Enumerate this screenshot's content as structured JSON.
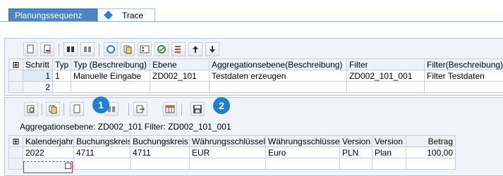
{
  "tabs": [
    {
      "label": "Planungssequenz",
      "active": true
    },
    {
      "label": "Trace",
      "active": false
    }
  ],
  "upper_grid": {
    "headers": [
      "Schritt",
      "Typ",
      "Typ (Beschreibung)",
      "Ebene",
      "Aggregationsebene(Beschreibung)",
      "Filter",
      "Filter(Beschreibung)"
    ],
    "rows": [
      [
        "1",
        "1",
        "Manuelle Eingabe",
        "ZD002_101",
        "Testdaten erzeugen",
        "ZD002_101_001",
        "Filter Testdaten"
      ],
      [
        "2",
        "",
        "",
        "",
        "",
        "",
        ""
      ]
    ]
  },
  "info_line": "Aggregationsebene: ZD002_101 Filter: ZD002_101_001",
  "lower_grid": {
    "headers": [
      "Kalenderjahr",
      "Buchungskreis",
      "Buchungskreis",
      "Währungsschlüssel",
      "Währungsschlüssel",
      "Version",
      "Version",
      "Betrag"
    ],
    "rows": [
      [
        "2022",
        "4711",
        "4711",
        "EUR",
        "Euro",
        "PLN",
        "Plan",
        "100,00"
      ]
    ]
  },
  "badges": [
    "1",
    "2"
  ],
  "colors": {
    "tab_active": "#4a86c5",
    "badge": "#1f7fd0",
    "focus_border": "#c73030"
  }
}
